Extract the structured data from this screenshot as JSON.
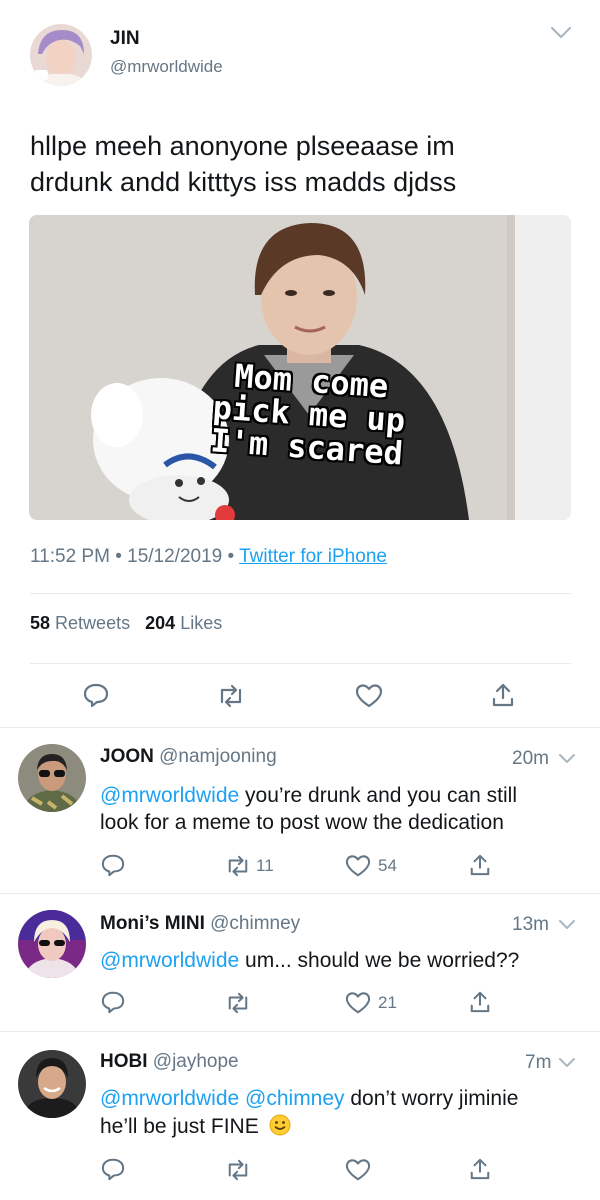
{
  "main_tweet": {
    "display_name": "JIN",
    "handle": "@mrworldwide",
    "text_line1": "hllpe meeh anonyone plseeaase im",
    "text_line2": "drdunk andd kitttys iss madds djdss",
    "meme_caption_line1": "Mom come",
    "meme_caption_line2": "pick me up",
    "meme_caption_line3": "I'm scared",
    "time": "11:52 PM",
    "date": "15/12/2019",
    "source": "Twitter for iPhone",
    "retweets_count": "58",
    "retweets_label": "Retweets",
    "likes_count": "204",
    "likes_label": "Likes"
  },
  "replies": [
    {
      "display_name": "JOON",
      "handle": "@namjooning",
      "time": "20m",
      "mention": "@mrworldwide",
      "text_line1": " you’re drunk and you can still",
      "text_line2": "look for a meme to post wow the dedication",
      "retweets": "11",
      "likes": "54"
    },
    {
      "display_name": "Moni’s MINI",
      "handle": "@chimney",
      "time": "13m",
      "mention": "@mrworldwide",
      "text_line1": " um... should we be worried??",
      "retweets": "",
      "likes": "21"
    },
    {
      "display_name": "HOBI",
      "handle": "@jayhope",
      "time": "7m",
      "mention": "@mrworldwide",
      "mention2": "@chimney",
      "text_line1": " don’t worry jiminie",
      "text_line2": "he’ll be just FINE",
      "retweets": "",
      "likes": ""
    }
  ],
  "colors": {
    "link": "#1da1f2",
    "muted": "#657786",
    "text": "#14171a",
    "divider": "#e6ecf0"
  },
  "icons": [
    "chevron-down-icon",
    "reply-icon",
    "retweet-icon",
    "like-icon",
    "share-icon",
    "slightly-smiling-emoji"
  ]
}
